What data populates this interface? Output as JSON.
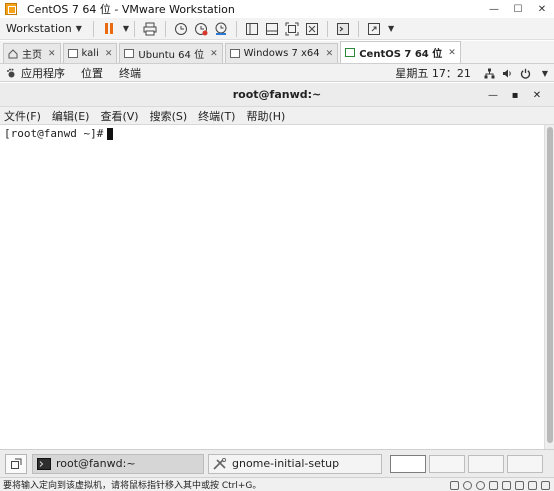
{
  "window": {
    "title": "CentOS 7 64 位 - VMware Workstation",
    "controls": [
      "—",
      "☐",
      "✕"
    ]
  },
  "toolbar": {
    "menu_label": "Workstation",
    "icons": [
      "pause-icon",
      "print-icon",
      "snapshot-icon",
      "revert-snapshot-icon",
      "snapshot-manager-icon",
      "view-normal-icon",
      "view-console-icon",
      "view-fit-icon",
      "view-unity-icon",
      "terminal-icon",
      "fullscreen-icon"
    ],
    "accent": "#e96a10"
  },
  "tabs": [
    {
      "label": "主页",
      "active": false
    },
    {
      "label": "kali",
      "active": false
    },
    {
      "label": "Ubuntu 64 位",
      "active": false
    },
    {
      "label": "Windows 7 x64",
      "active": false
    },
    {
      "label": "CentOS 7 64 位",
      "active": true
    }
  ],
  "tab_close_glyph": "✕",
  "gnome_top": {
    "menus": [
      "应用程序",
      "位置",
      "终端"
    ],
    "clock": "星期五 17：21",
    "icons": [
      "network-icon",
      "volume-icon",
      "power-icon"
    ]
  },
  "terminal": {
    "title": "root@fanwd:~",
    "controls": [
      "—",
      "▪",
      "✕"
    ],
    "menus": [
      "文件(F)",
      "编辑(E)",
      "查看(V)",
      "搜索(S)",
      "终端(T)",
      "帮助(H)"
    ],
    "prompt": "[root@fanwd ~]#"
  },
  "taskbar": {
    "items": [
      {
        "label": "root@fanwd:~",
        "active": true
      },
      {
        "label": "gnome-initial-setup",
        "active": false
      }
    ],
    "workspaces": 4
  },
  "statusbar": {
    "text": "要将输入定向到该虚拟机，请将鼠标指针移入其中或按 Ctrl+G。"
  }
}
